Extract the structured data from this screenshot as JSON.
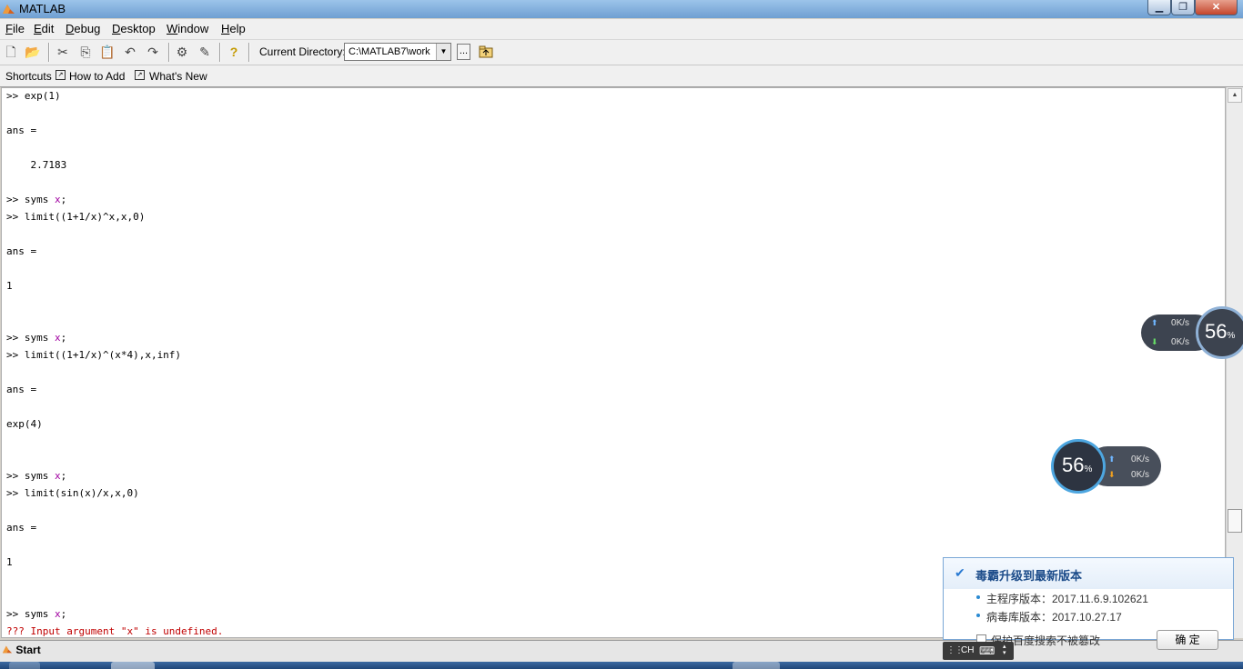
{
  "window": {
    "title": "MATLAB",
    "min": "▁",
    "max": "❐",
    "close": "✕"
  },
  "menu": [
    {
      "mnemonic": "F",
      "rest": "ile"
    },
    {
      "mnemonic": "E",
      "rest": "dit"
    },
    {
      "mnemonic": "D",
      "rest": "ebug"
    },
    {
      "mnemonic": "D",
      "rest": "esktop"
    },
    {
      "mnemonic": "W",
      "rest": "indow"
    },
    {
      "mnemonic": "H",
      "rest": "elp"
    }
  ],
  "toolbar": {
    "current_dir_label": "Current Directory:",
    "current_dir_value": "C:\\MATLAB7\\work",
    "browse_label": "..."
  },
  "shortcuts": {
    "label": "Shortcuts",
    "how_to_add": "How to Add",
    "whats_new": "What's New"
  },
  "console": {
    "l1": ">> exp(1)",
    "l2": "ans =",
    "l3": "    2.7183",
    "l4a": ">> syms ",
    "l4b": "x",
    "l4c": ";",
    "l5": ">> limit((1+1/x)^x,x,0)",
    "l6": "ans =",
    "l7": "1",
    "l8a": ">> syms ",
    "l8b": "x",
    "l8c": ";",
    "l9": ">> limit((1+1/x)^(x*4),x,inf)",
    "l10": "ans =",
    "l11": "exp(4)",
    "l12a": ">> syms ",
    "l12b": "x",
    "l12c": ";",
    "l13": ">> limit(sin(x)/x,x,0)",
    "l14": "ans =",
    "l15": "1",
    "l16a": ">> syms ",
    "l16b": "x",
    "l16c": ";",
    "l17": "??? Input argument \"x\" is undefined."
  },
  "start": {
    "label": "Start"
  },
  "widget_a": {
    "percent": "56",
    "pct_sign": "%",
    "up": "0",
    "down": "0",
    "unit": "K/s"
  },
  "widget_b": {
    "percent": "56",
    "pct_sign": "%",
    "up": "0",
    "down": "0",
    "unit": "K/s"
  },
  "popup": {
    "title": "毒霸升级到最新版本",
    "main_version": "主程序版本：2017.11.6.9.102621",
    "virus_version": "病毒库版本：2017.10.27.17",
    "checkbox_label": "保护百度搜索不被篡改",
    "ok_label": "确 定"
  },
  "ime": {
    "label": "CH"
  },
  "icons": {
    "new": "🗋",
    "open": "📂",
    "cut": "✂",
    "copy": "⎘",
    "paste": "📋",
    "undo": "↶",
    "redo": "↷",
    "simulink": "⚙",
    "guide": "✎",
    "help": "?"
  }
}
